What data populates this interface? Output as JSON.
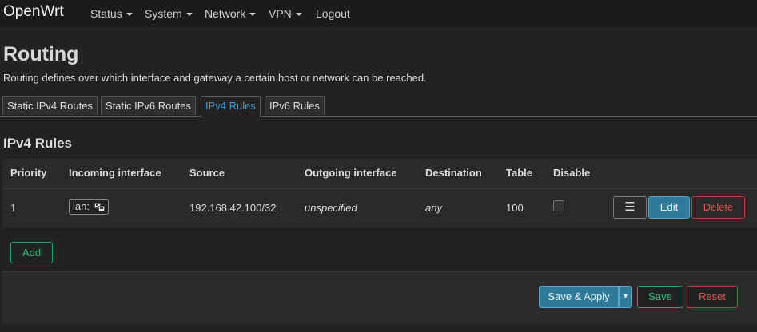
{
  "brand": "OpenWrt",
  "nav": [
    {
      "label": "Status",
      "dropdown": true
    },
    {
      "label": "System",
      "dropdown": true
    },
    {
      "label": "Network",
      "dropdown": true
    },
    {
      "label": "VPN",
      "dropdown": true
    },
    {
      "label": "Logout",
      "dropdown": false
    }
  ],
  "page": {
    "title": "Routing",
    "description": "Routing defines over which interface and gateway a certain host or network can be reached."
  },
  "tabs": [
    {
      "label": "Static IPv4 Routes",
      "active": false
    },
    {
      "label": "Static IPv6 Routes",
      "active": false
    },
    {
      "label": "IPv4 Rules",
      "active": true
    },
    {
      "label": "IPv6 Rules",
      "active": false
    }
  ],
  "section": {
    "title": "IPv4 Rules",
    "columns": [
      "Priority",
      "Incoming interface",
      "Source",
      "Outgoing interface",
      "Destination",
      "Table",
      "Disable"
    ],
    "rows": [
      {
        "priority": "1",
        "incoming": "lan:",
        "incoming_icon": "network-interface-icon",
        "source": "192.168.42.100/32",
        "outgoing": "unspecified",
        "destination": "any",
        "table": "100",
        "disabled": false
      }
    ],
    "row_buttons": {
      "menu": "☰",
      "edit": "Edit",
      "delete": "Delete"
    },
    "add_label": "Add"
  },
  "footer": {
    "save_apply": "Save & Apply",
    "dropdown_glyph": "▾",
    "save": "Save",
    "reset": "Reset"
  },
  "colors": {
    "accent": "#3b9ed6",
    "positive": "#34b87c",
    "negative": "#d9534f",
    "background": "#222222"
  }
}
